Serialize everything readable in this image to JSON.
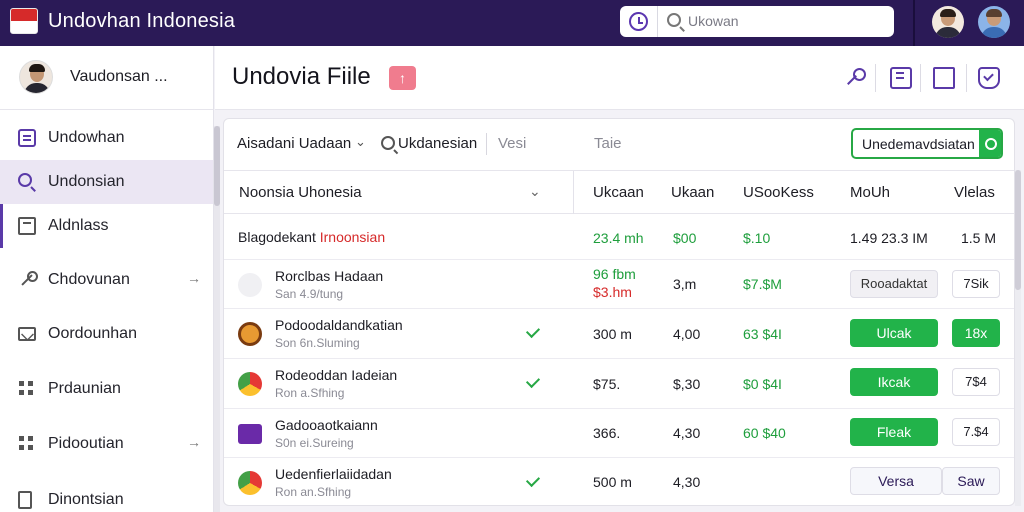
{
  "app": {
    "title": "Undovhan Indonesia"
  },
  "search": {
    "placeholder": "Ukowan"
  },
  "user": {
    "name": "Vaudonsan ..."
  },
  "sidebar": {
    "items": [
      {
        "label": "Undowhan",
        "icon": "list-icon"
      },
      {
        "label": "Undonsian",
        "icon": "search-icon"
      },
      {
        "label": "Aldnlass",
        "icon": "box-icon"
      },
      {
        "label": "Chdovunan",
        "icon": "wrench-icon",
        "chevron": "→"
      },
      {
        "label": "Oordounhan",
        "icon": "envelope-icon"
      },
      {
        "label": "Prdaunian",
        "icon": "grid-icon"
      },
      {
        "label": "Pidooutian",
        "icon": "grid-icon",
        "chevron": "→"
      },
      {
        "label": "Dinontsian",
        "icon": "document-icon"
      }
    ]
  },
  "header": {
    "title": "Undovia Fiile",
    "badge": "↑"
  },
  "filters": {
    "select_label": "Aisadani Uadaan",
    "chevron": "⌄",
    "search_label": "Ukdanesian",
    "vers_label": "Vesi",
    "tale_label": "Taie",
    "primary_button": "Unedemavdsiatan"
  },
  "table": {
    "columns": [
      "Noonsia Uhonesia",
      "Ukcaan",
      "Ukaan",
      "USooKess",
      "MoUh",
      "Vlelas"
    ],
    "sort_icon": "⌄",
    "summary_row": {
      "label": "Blagodekant",
      "label_highlight": "Irnoonsian",
      "c1": "23.4 mh",
      "c2": "$00",
      "c3": "$.10",
      "c4": "1.49 23.3 IM",
      "c5": "1.5 M"
    },
    "rows": [
      {
        "name": "Rorclbas Hadaan",
        "sub": "San 4.9/tung",
        "icon": "app-icon-grey",
        "check": false,
        "c1_top": "96 fbm",
        "c1_bottom": "$3.hm",
        "c2": "3,m",
        "c3": "$7.$M",
        "action1": "Rooadaktat",
        "action2": "7Sik",
        "action1_style": "grey",
        "action2_style": "white"
      },
      {
        "name": "Podoodaldandkatian",
        "sub": "Son 6n.Sluming",
        "icon": "app-icon-orange",
        "check": true,
        "c1": "300 m",
        "c2": "4,00",
        "c3": "63 $4I",
        "action1": "Ulcak",
        "action2": "18x",
        "action1_style": "green",
        "action2_style": "green"
      },
      {
        "name": "Rodeoddan Iadeian",
        "sub": "Ron a.Sfhing",
        "icon": "app-icon-chrome",
        "check": true,
        "c1": "$75.",
        "c2": "$,30",
        "c3": "$0 $4I",
        "action1": "Ikcak",
        "action2": "7$4",
        "action1_style": "green",
        "action2_style": "white"
      },
      {
        "name": "Gadooaotkaiann",
        "sub": "S0n ei.Sureing",
        "icon": "app-icon-purple",
        "check": false,
        "c1": "366.",
        "c2": "4,30",
        "c3": "60 $40",
        "action1": "Fleak",
        "action2": "7.$4",
        "action1_style": "green",
        "action2_style": "white"
      },
      {
        "name": "Uedenfierlaiidadan",
        "sub": "Ron an.Sfhing",
        "icon": "app-icon-chrome",
        "check": true,
        "c1": "500 m",
        "c2": "4,30",
        "c3": "",
        "action1": "Versa",
        "action2": "Saw",
        "action1_style": "outline",
        "action2_style": "outline"
      }
    ]
  },
  "colors": {
    "topbar": "#2b1a57",
    "accent": "#5a3aa8",
    "green": "#22b34a",
    "red": "#d62a2a",
    "badge": "#f07c8e"
  }
}
